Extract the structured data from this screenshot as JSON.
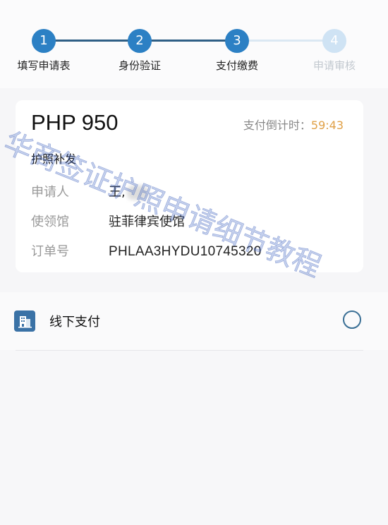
{
  "steps": [
    {
      "number": "1",
      "label": "填写申请表",
      "state": "done"
    },
    {
      "number": "2",
      "label": "身份验证",
      "state": "done"
    },
    {
      "number": "3",
      "label": "支付缴费",
      "state": "current"
    },
    {
      "number": "4",
      "label": "申请审核",
      "state": "pending"
    }
  ],
  "colors": {
    "step_active": "#2c80c4",
    "step_pending": "#cfe3f4",
    "line_active": "#2f5f86",
    "line_pending": "#dbe8f3",
    "countdown_time": "#e0a046"
  },
  "order": {
    "amount": "PHP 950",
    "countdown_label": "支付倒计时：",
    "countdown_time": "59:43",
    "service": "护照补发",
    "applicant_label": "申请人",
    "applicant_value": "王,",
    "embassy_label": "使领馆",
    "embassy_value": "驻菲律宾使馆",
    "order_no_label": "订单号",
    "order_no_value": "PHLAA3HYDU10745320"
  },
  "payment": {
    "label": "线下支付",
    "icon": "building-icon",
    "selected": false
  },
  "watermark": "华商签证护照申请细节教程"
}
